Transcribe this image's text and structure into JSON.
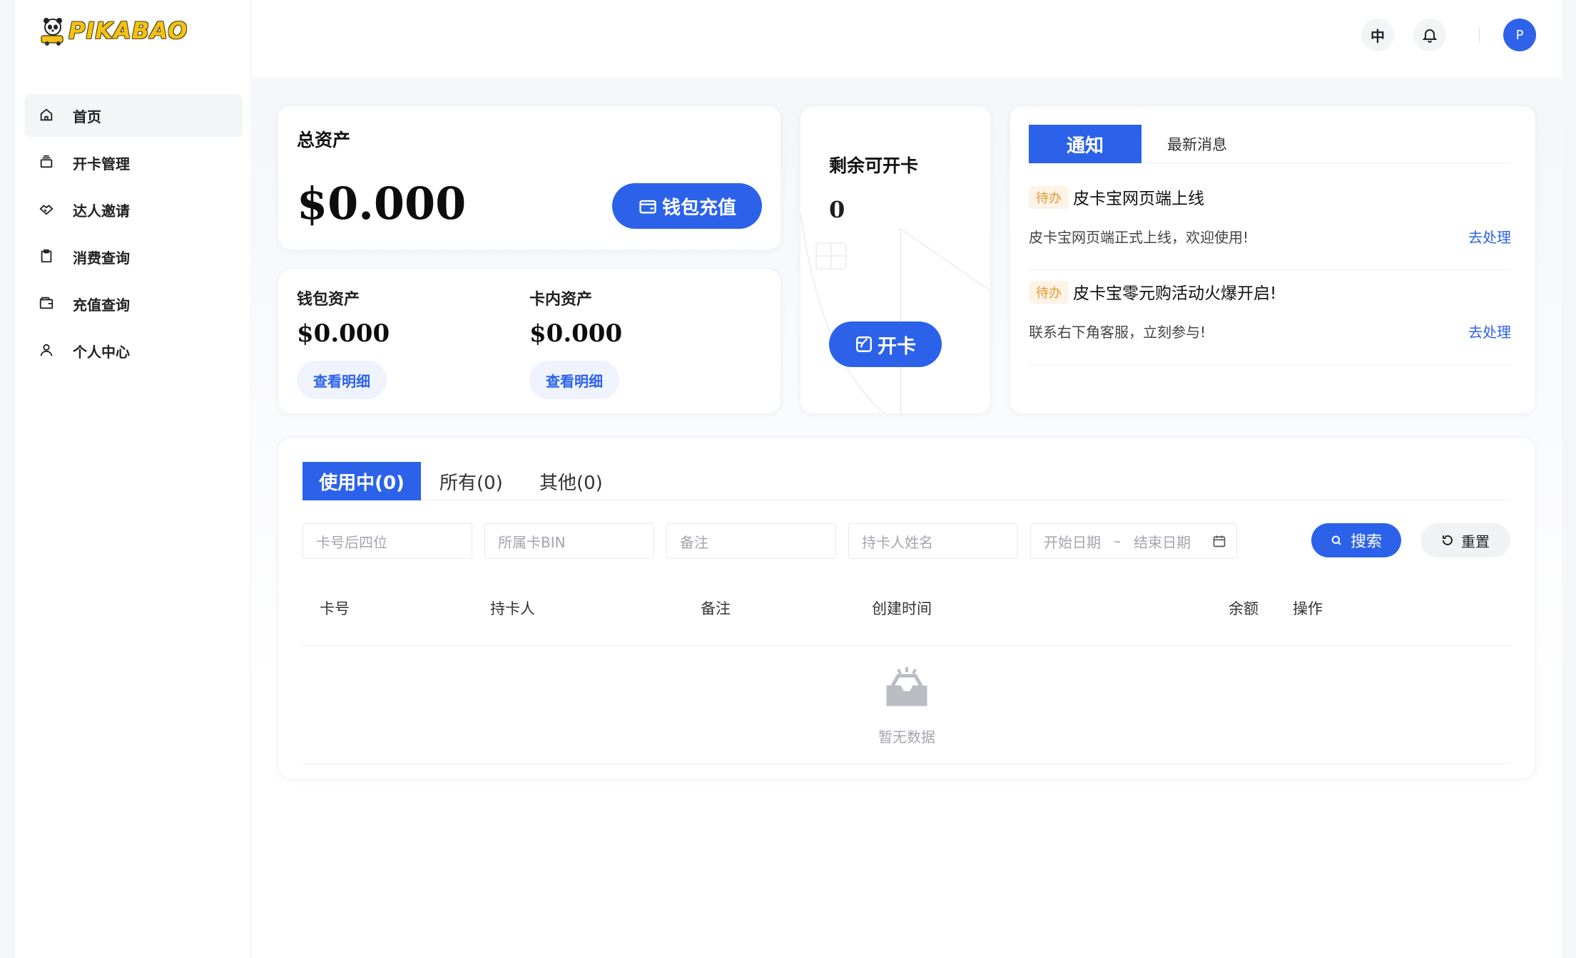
{
  "app": {
    "logo_text": "PIKABAO"
  },
  "sidebar": {
    "items": [
      {
        "label": "首页",
        "icon": "home-icon",
        "active": true
      },
      {
        "label": "开卡管理",
        "icon": "card-stack-icon",
        "active": false
      },
      {
        "label": "达人邀请",
        "icon": "handshake-icon",
        "active": false
      },
      {
        "label": "消费查询",
        "icon": "clipboard-icon",
        "active": false
      },
      {
        "label": "充值查询",
        "icon": "wallet-icon",
        "active": false
      },
      {
        "label": "个人中心",
        "icon": "user-icon",
        "active": false
      }
    ]
  },
  "topbar": {
    "lang_label": "中",
    "bell_icon": "bell-icon",
    "avatar_letter": "P"
  },
  "total_assets": {
    "title": "总资产",
    "amount": "$0.000",
    "recharge_label": "钱包充值"
  },
  "wallet_assets": {
    "title": "钱包资产",
    "amount": "$0.000",
    "detail_label": "查看明细"
  },
  "card_assets": {
    "title": "卡内资产",
    "amount": "$0.000",
    "detail_label": "查看明细"
  },
  "open_card": {
    "title": "剩余可开卡",
    "count": "0",
    "button_label": "开卡"
  },
  "notices": {
    "tab_active": "通知",
    "tab_other": "最新消息",
    "items": [
      {
        "badge": "待办",
        "title": "皮卡宝网页端上线",
        "body": "皮卡宝网页端正式上线，欢迎使用!",
        "action": "去处理"
      },
      {
        "badge": "待办",
        "title": "皮卡宝零元购活动火爆开启!",
        "body": "联系右下角客服，立刻参与!",
        "action": "去处理"
      }
    ]
  },
  "cards_panel": {
    "tabs": [
      "使用中(0)",
      "所有(0)",
      "其他(0)"
    ],
    "filters": {
      "card_last4": "卡号后四位",
      "card_bin": "所属卡BIN",
      "remark": "备注",
      "holder_name": "持卡人姓名",
      "start_date": "开始日期",
      "date_sep": "–",
      "end_date": "结束日期",
      "search_label": "搜索",
      "reset_label": "重置"
    },
    "columns": [
      "卡号",
      "持卡人",
      "备注",
      "创建时间",
      "余额",
      "操作"
    ],
    "empty_text": "暂无数据"
  },
  "colors": {
    "primary": "#2c62ea",
    "badge_text": "#e9962e",
    "logo": "#f2c316"
  }
}
